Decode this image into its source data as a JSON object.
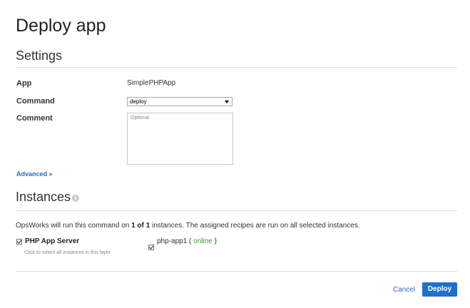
{
  "page": {
    "title": "Deploy app"
  },
  "settings": {
    "title": "Settings",
    "app_label": "App",
    "app_value": "SimplePHPApp",
    "command_label": "Command",
    "command_value": "deploy",
    "comment_label": "Comment",
    "comment_placeholder": "Optional",
    "advanced_link": "Advanced »"
  },
  "instances": {
    "title": "Instances",
    "info_icon": "i",
    "desc_prefix": "OpsWorks will run this command on ",
    "desc_count": "1 of 1",
    "desc_suffix": " instances. The assigned recipes are run on all selected instances.",
    "layer_label": "PHP App Server",
    "layer_hint": "Click to select all instances in this layer",
    "instance_name": "php-app1",
    "instance_paren_open": " ( ",
    "instance_status": "online",
    "instance_paren_close": " )"
  },
  "footer": {
    "cancel_label": "Cancel",
    "deploy_label": "Deploy"
  },
  "colors": {
    "link": "#2a6ebb",
    "primary_button": "#1f6fcf",
    "online": "#3c9a3c"
  }
}
